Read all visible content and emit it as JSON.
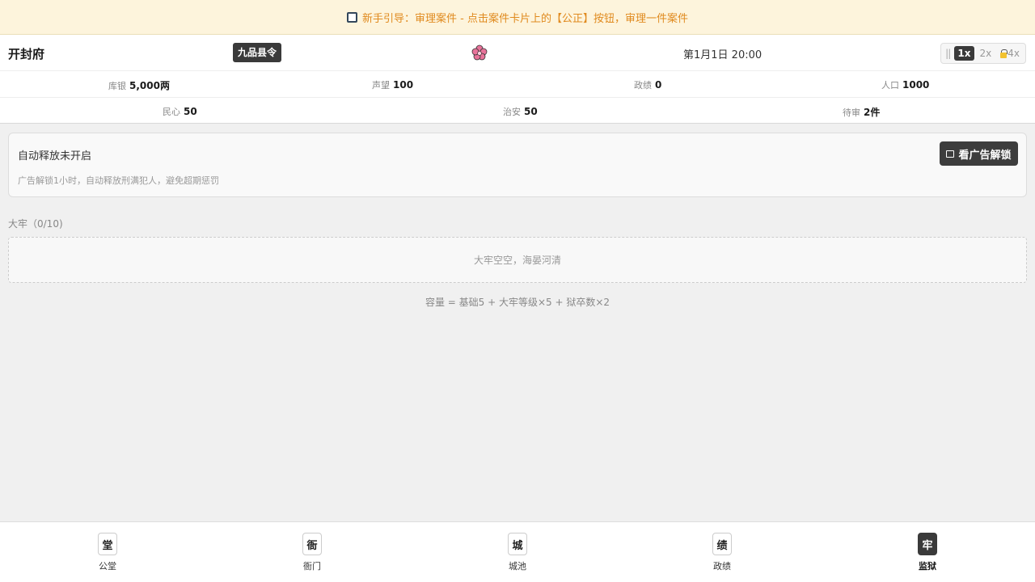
{
  "guide": {
    "icon": "checkbox-icon",
    "text": "新手引导：审理案件 - 点击案件卡片上的【公正】按钮，审理一件案件"
  },
  "header": {
    "city": "开封府",
    "rank": "九品县令",
    "mascot_icon": "flower-icon",
    "date": "第1月1日 20:00",
    "speed": {
      "pause": "||",
      "x1": "1x",
      "x2": "2x",
      "x4": "4x",
      "active": "1x"
    }
  },
  "stats_row1": [
    {
      "label": "库银",
      "value": "5,000两"
    },
    {
      "label": "声望",
      "value": "100"
    },
    {
      "label": "政绩",
      "value": "0"
    },
    {
      "label": "人口",
      "value": "1000"
    }
  ],
  "stats_row2": [
    {
      "label": "民心",
      "value": "50"
    },
    {
      "label": "治安",
      "value": "50"
    },
    {
      "label": "待审",
      "value": "2件"
    }
  ],
  "auto_release": {
    "title": "自动释放未开启",
    "desc": "广告解锁1小时，自动释放刑满犯人，避免超期惩罚",
    "button_label": "看广告解锁",
    "button_icon": "tv-icon"
  },
  "jail": {
    "title": "大牢（0/10)",
    "empty_text": "大牢空空，海晏河清",
    "formula": "容量 = 基础5 + 大牢等级×5 + 狱卒数×2"
  },
  "nav": [
    {
      "icon": "堂",
      "label": "公堂",
      "active": false
    },
    {
      "icon": "衙",
      "label": "衙门",
      "active": false
    },
    {
      "icon": "城",
      "label": "城池",
      "active": false
    },
    {
      "icon": "绩",
      "label": "政绩",
      "active": false
    },
    {
      "icon": "牢",
      "label": "监狱",
      "active": true
    }
  ],
  "colors": {
    "guide_bg": "#fdf4dc",
    "guide_text": "#e08a1e",
    "dark": "#3a3a3a",
    "flower": "#e8739a"
  }
}
